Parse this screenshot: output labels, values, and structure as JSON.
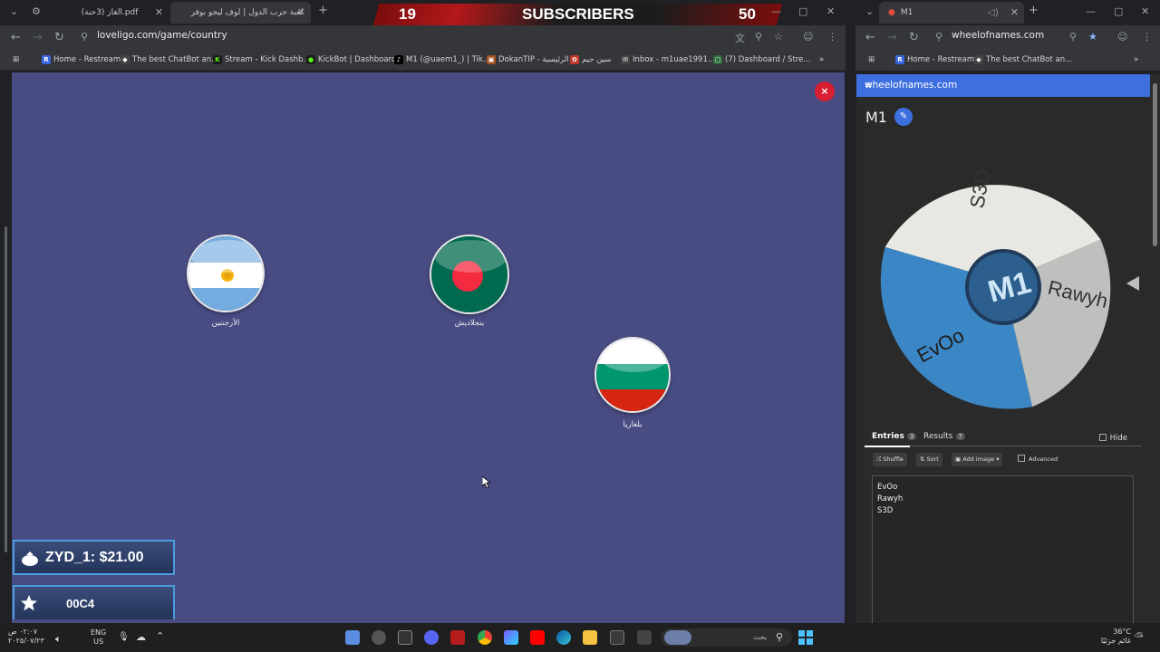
{
  "left_window": {
    "tabs": [
      {
        "label": "الغاز (3حنة).pdf"
      },
      {
        "label": "لعبة حرب الدول | لوف ليجو بوفر"
      }
    ],
    "new_tab": "+",
    "overlay": {
      "left_number": "19",
      "title": "SUBSCRIBERS",
      "right_number": "50"
    },
    "url": "loveligo.com/game/country",
    "bookmarks": [
      {
        "label": "Home - Restream",
        "icon": "R",
        "color": "#3766e0"
      },
      {
        "label": "The best ChatBot an...",
        "icon": "◆",
        "color": "#444444"
      },
      {
        "label": "Stream - Kick Dashb...",
        "icon": "K",
        "color": "#1b1b1b"
      },
      {
        "label": "KickBot | Dashboard",
        "icon": "●",
        "color": "#1b1b1b"
      },
      {
        "label": "M1 (@uaem1_) | Tik...",
        "icon": "♪",
        "color": "#000000"
      },
      {
        "label": "DokanTIP - الرئيسية",
        "icon": "▣",
        "color": "#a0521e"
      },
      {
        "label": "سين جيم",
        "icon": "✿",
        "color": "#c0392b"
      },
      {
        "label": "Inbox - m1uae1991...",
        "icon": "✉",
        "color": "#444444"
      },
      {
        "label": "(7) Dashboard / Stre...",
        "icon": "▢",
        "color": "#2b6b3c"
      }
    ],
    "game": {
      "close": "×",
      "countries": [
        {
          "name": "الأرجنتين",
          "flag": "argentina"
        },
        {
          "name": "بنجلاديش",
          "flag": "bangladesh"
        },
        {
          "name": "بلغاريا",
          "flag": "bulgaria"
        }
      ]
    },
    "donation": {
      "text": "ZYD_1: $21.00",
      "icon": "money-bag-icon"
    },
    "follower": {
      "text": "00C4",
      "icon": "star-icon"
    }
  },
  "right_window": {
    "tab_title": "M1",
    "url": "wheelofnames.com",
    "bookmarks": [
      {
        "label": "Home - Restream",
        "icon": "R",
        "color": "#3766e0"
      },
      {
        "label": "The best ChatBot an...",
        "icon": "◆",
        "color": "#444444"
      }
    ],
    "header": "wheelofnames.com",
    "wheel_title": "M1",
    "wheel_segments": [
      {
        "name": "S3D",
        "color": "#e8e7e2"
      },
      {
        "name": "Rawyh",
        "color": "#bfbfbd"
      },
      {
        "name": "EvOo",
        "color": "#3b86c4"
      }
    ],
    "tabs": {
      "entries": "Entries",
      "entries_count": "3",
      "results": "Results",
      "results_count": "7"
    },
    "hide": "Hide",
    "buttons": {
      "shuffle": "Shuffle",
      "sort": "Sort",
      "add_image": "Add image",
      "advanced": "Advanced"
    },
    "entries": [
      "EvOo",
      "Rawyh",
      "S3D"
    ]
  },
  "taskbar": {
    "time": "٠٢:٠٧ ص",
    "date": "٢٠٢٥/٠٧/٢٣",
    "lang": "ENG",
    "region": "US",
    "search_placeholder": "بحث",
    "weather_temp": "36°C",
    "weather_desc": "غائم جزئيًا"
  }
}
